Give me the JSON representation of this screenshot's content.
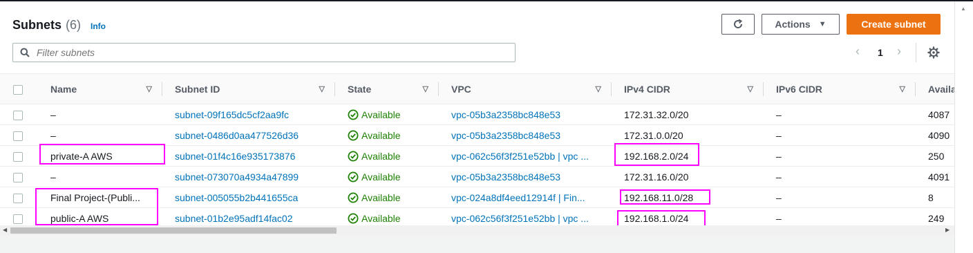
{
  "header": {
    "title": "Subnets",
    "count": "(6)",
    "info": "Info"
  },
  "toolbar": {
    "actions_label": "Actions",
    "create_label": "Create subnet"
  },
  "search": {
    "placeholder": "Filter subnets",
    "value": ""
  },
  "pagination": {
    "prev": "‹",
    "page": "1",
    "next": "›"
  },
  "columns": [
    "Name",
    "Subnet ID",
    "State",
    "VPC",
    "IPv4 CIDR",
    "IPv6 CIDR",
    "Availa"
  ],
  "rows": [
    {
      "name": "–",
      "subnet_id": "subnet-09f165dc5cf2aa9fc",
      "state": "Available",
      "vpc": "vpc-05b3a2358bc848e53",
      "ipv4": "172.31.32.0/20",
      "ipv6": "–",
      "avail": "4087"
    },
    {
      "name": "–",
      "subnet_id": "subnet-0486d0aa477526d36",
      "state": "Available",
      "vpc": "vpc-05b3a2358bc848e53",
      "ipv4": "172.31.0.0/20",
      "ipv6": "–",
      "avail": "4090"
    },
    {
      "name": "private-A AWS",
      "subnet_id": "subnet-01f4c16e935173876",
      "state": "Available",
      "vpc": "vpc-062c56f3f251e52bb | vpc ...",
      "ipv4": "192.168.2.0/24",
      "ipv6": "–",
      "avail": "250"
    },
    {
      "name": "–",
      "subnet_id": "subnet-073070a4934a47899",
      "state": "Available",
      "vpc": "vpc-05b3a2358bc848e53",
      "ipv4": "172.31.16.0/20",
      "ipv6": "–",
      "avail": "4091"
    },
    {
      "name": "Final Project-(Publi...",
      "subnet_id": "subnet-005055b2b441655ca",
      "state": "Available",
      "vpc": "vpc-024a8df4eed12914f | Fin...",
      "ipv4": "192.168.11.0/28",
      "ipv6": "–",
      "avail": "8"
    },
    {
      "name": "public-A AWS",
      "subnet_id": "subnet-01b2e95adf14fac02",
      "state": "Available",
      "vpc": "vpc-062c56f3f251e52bb | vpc ...",
      "ipv4": "192.168.1.0/24",
      "ipv6": "–",
      "avail": "249"
    }
  ],
  "colors": {
    "accent": "#ec7211",
    "link": "#0073bb",
    "available": "#1d8102",
    "highlight": "#ff00ff"
  },
  "icons": [
    "refresh-icon",
    "caret-down-icon",
    "search-icon",
    "settings-gear-icon",
    "sort-icon",
    "check-circle-icon"
  ]
}
